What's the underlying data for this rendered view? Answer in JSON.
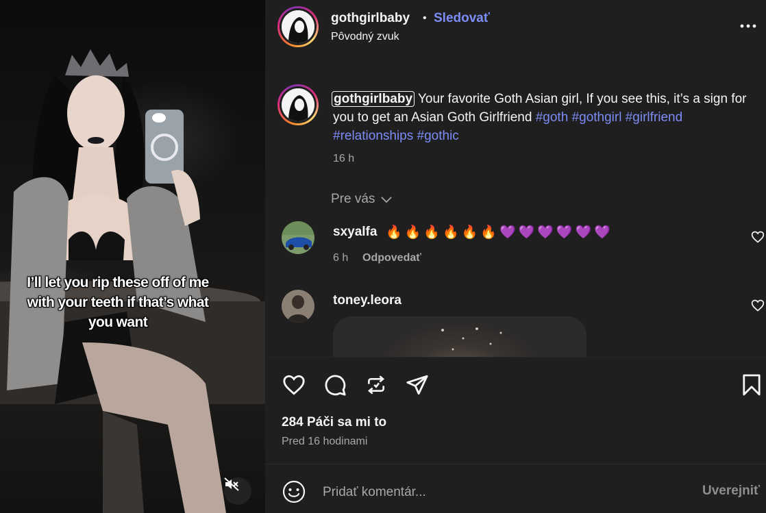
{
  "post": {
    "username": "gothgirlbaby",
    "separator": "•",
    "follow_label": "Sledovať",
    "audio": "Pôvodný zvuk",
    "more_icon": "more-horizontal-icon"
  },
  "media": {
    "overlay_caption": "I’ll let you rip these off of me with your teeth if that’s what you want",
    "mute_icon": "speaker-muted-icon"
  },
  "caption": {
    "username": "gothgirlbaby",
    "text": " Your favorite Goth Asian girl, If you see this, it’s a sign for you to get an Asian Goth Girlfriend ",
    "hashtags": [
      "#goth",
      "#gothgirl",
      "#girlfriend",
      "#relationships",
      "#gothic"
    ],
    "time": "16 h"
  },
  "filter": {
    "label": "Pre vás",
    "icon": "chevron-down-icon"
  },
  "comments": [
    {
      "username": "sxyalfa",
      "text": "🔥🔥🔥🔥🔥🔥💜💜💜💜💜💜",
      "time": "6 h",
      "reply_label": "Odpovedať"
    },
    {
      "username": "toney.leora",
      "text": "",
      "gif": true
    }
  ],
  "actions": {
    "like_icon": "heart-icon",
    "comment_icon": "comment-icon",
    "repost_icon": "repost-icon",
    "share_icon": "send-icon",
    "save_icon": "bookmark-icon",
    "likes": "284 Páči sa mi to",
    "posted": "Pred 16 hodinami"
  },
  "composer": {
    "placeholder": "Pridať komentár...",
    "post_label": "Uverejniť",
    "emoji_icon": "emoji-icon"
  },
  "colors": {
    "accent": "#7d8cf6",
    "panel_bg": "#1f1f1f",
    "muted_text": "#a8a8a8"
  }
}
